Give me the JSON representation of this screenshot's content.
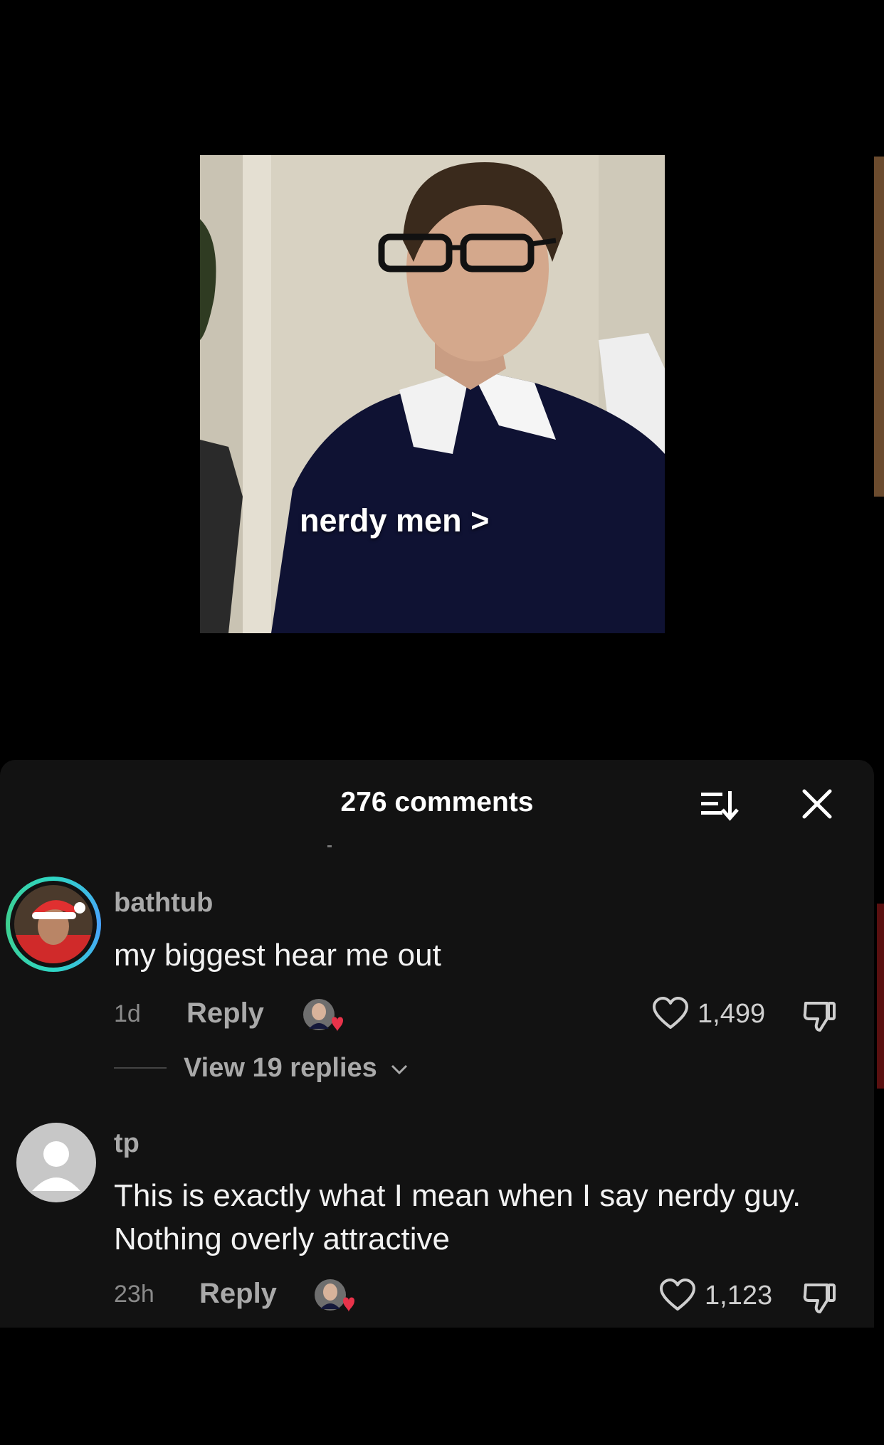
{
  "video": {
    "caption": "nerdy men >"
  },
  "comments_panel": {
    "count_label": "276 comments",
    "icons": {
      "sort": "sort-icon",
      "close": "close-icon"
    }
  },
  "comments": [
    {
      "username": "bathtub",
      "text": "my biggest hear me out",
      "time": "1d",
      "reply_label": "Reply",
      "likes": "1,499",
      "view_replies": "View 19 replies"
    },
    {
      "username": "tp",
      "text": "This is exactly what I mean when I say nerdy guy. Nothing overly attractive",
      "time": "23h",
      "reply_label": "Reply",
      "likes": "1,123"
    }
  ],
  "colors": {
    "panel_bg": "#121212",
    "secondary_text": "#a9a9a9",
    "creator_heart": "#e8334a"
  }
}
